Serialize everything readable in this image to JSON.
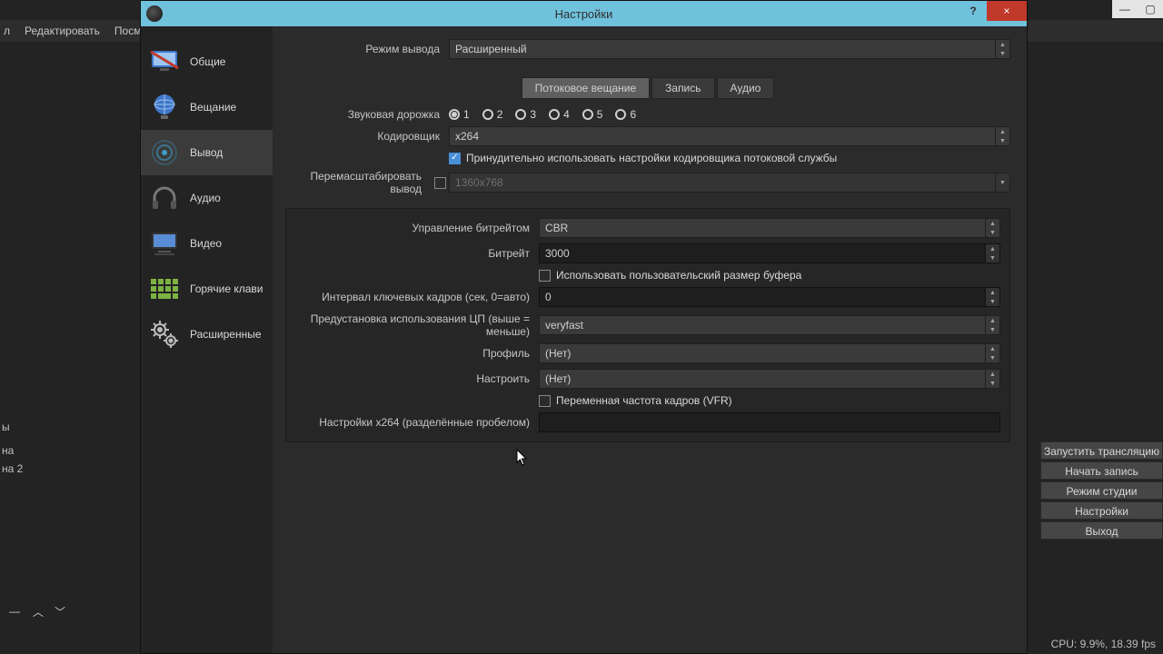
{
  "main": {
    "menu": {
      "item1": "л",
      "item2": "Редактировать",
      "item3": "Посм"
    },
    "leftList": {
      "r1": "ы",
      "r2": "на",
      "r3": "на 2"
    },
    "buttons": {
      "start": "Запустить трансляцию",
      "record": "Начать запись",
      "studio": "Режим студии",
      "settings": "Настройки",
      "exit": "Выход"
    },
    "status": "CPU: 9.9%, 18.39 fps"
  },
  "dialog": {
    "title": "Настройки",
    "help": "?",
    "close": "×"
  },
  "sidebar": {
    "general": "Общие",
    "stream": "Вещание",
    "output": "Вывод",
    "audio": "Аудио",
    "video": "Видео",
    "hotkeys": "Горячие клави",
    "advanced": "Расширенные"
  },
  "content": {
    "outputModeLabel": "Режим вывода",
    "outputModeValue": "Расширенный",
    "tabs": {
      "streaming": "Потоковое вещание",
      "recording": "Запись",
      "audio": "Аудио"
    },
    "audioTrackLabel": "Звуковая дорожка",
    "tracks": {
      "t1": "1",
      "t2": "2",
      "t3": "3",
      "t4": "4",
      "t5": "5",
      "t6": "6"
    },
    "encoderLabel": "Кодировщик",
    "encoderValue": "x264",
    "enforceLabel": "Принудительно использовать настройки кодировщика потоковой службы",
    "rescaleLabel": "Перемасштабировать вывод",
    "rescaleValue": "1360x768",
    "rateControlLabel": "Управление битрейтом",
    "rateControlValue": "CBR",
    "bitrateLabel": "Битрейт",
    "bitrateValue": "3000",
    "customBufLabel": "Использовать пользовательский размер буфера",
    "keyintLabel": "Интервал ключевых кадров (сек, 0=авто)",
    "keyintValue": "0",
    "presetLabel": "Предустановка использования ЦП (выше = меньше)",
    "presetValue": "veryfast",
    "profileLabel": "Профиль",
    "profileValue": "(Нет)",
    "tuneLabel": "Настроить",
    "tuneValue": "(Нет)",
    "vfrLabel": "Переменная частота кадров (VFR)",
    "x264optsLabel": "Настройки x264 (разделённые пробелом)"
  }
}
